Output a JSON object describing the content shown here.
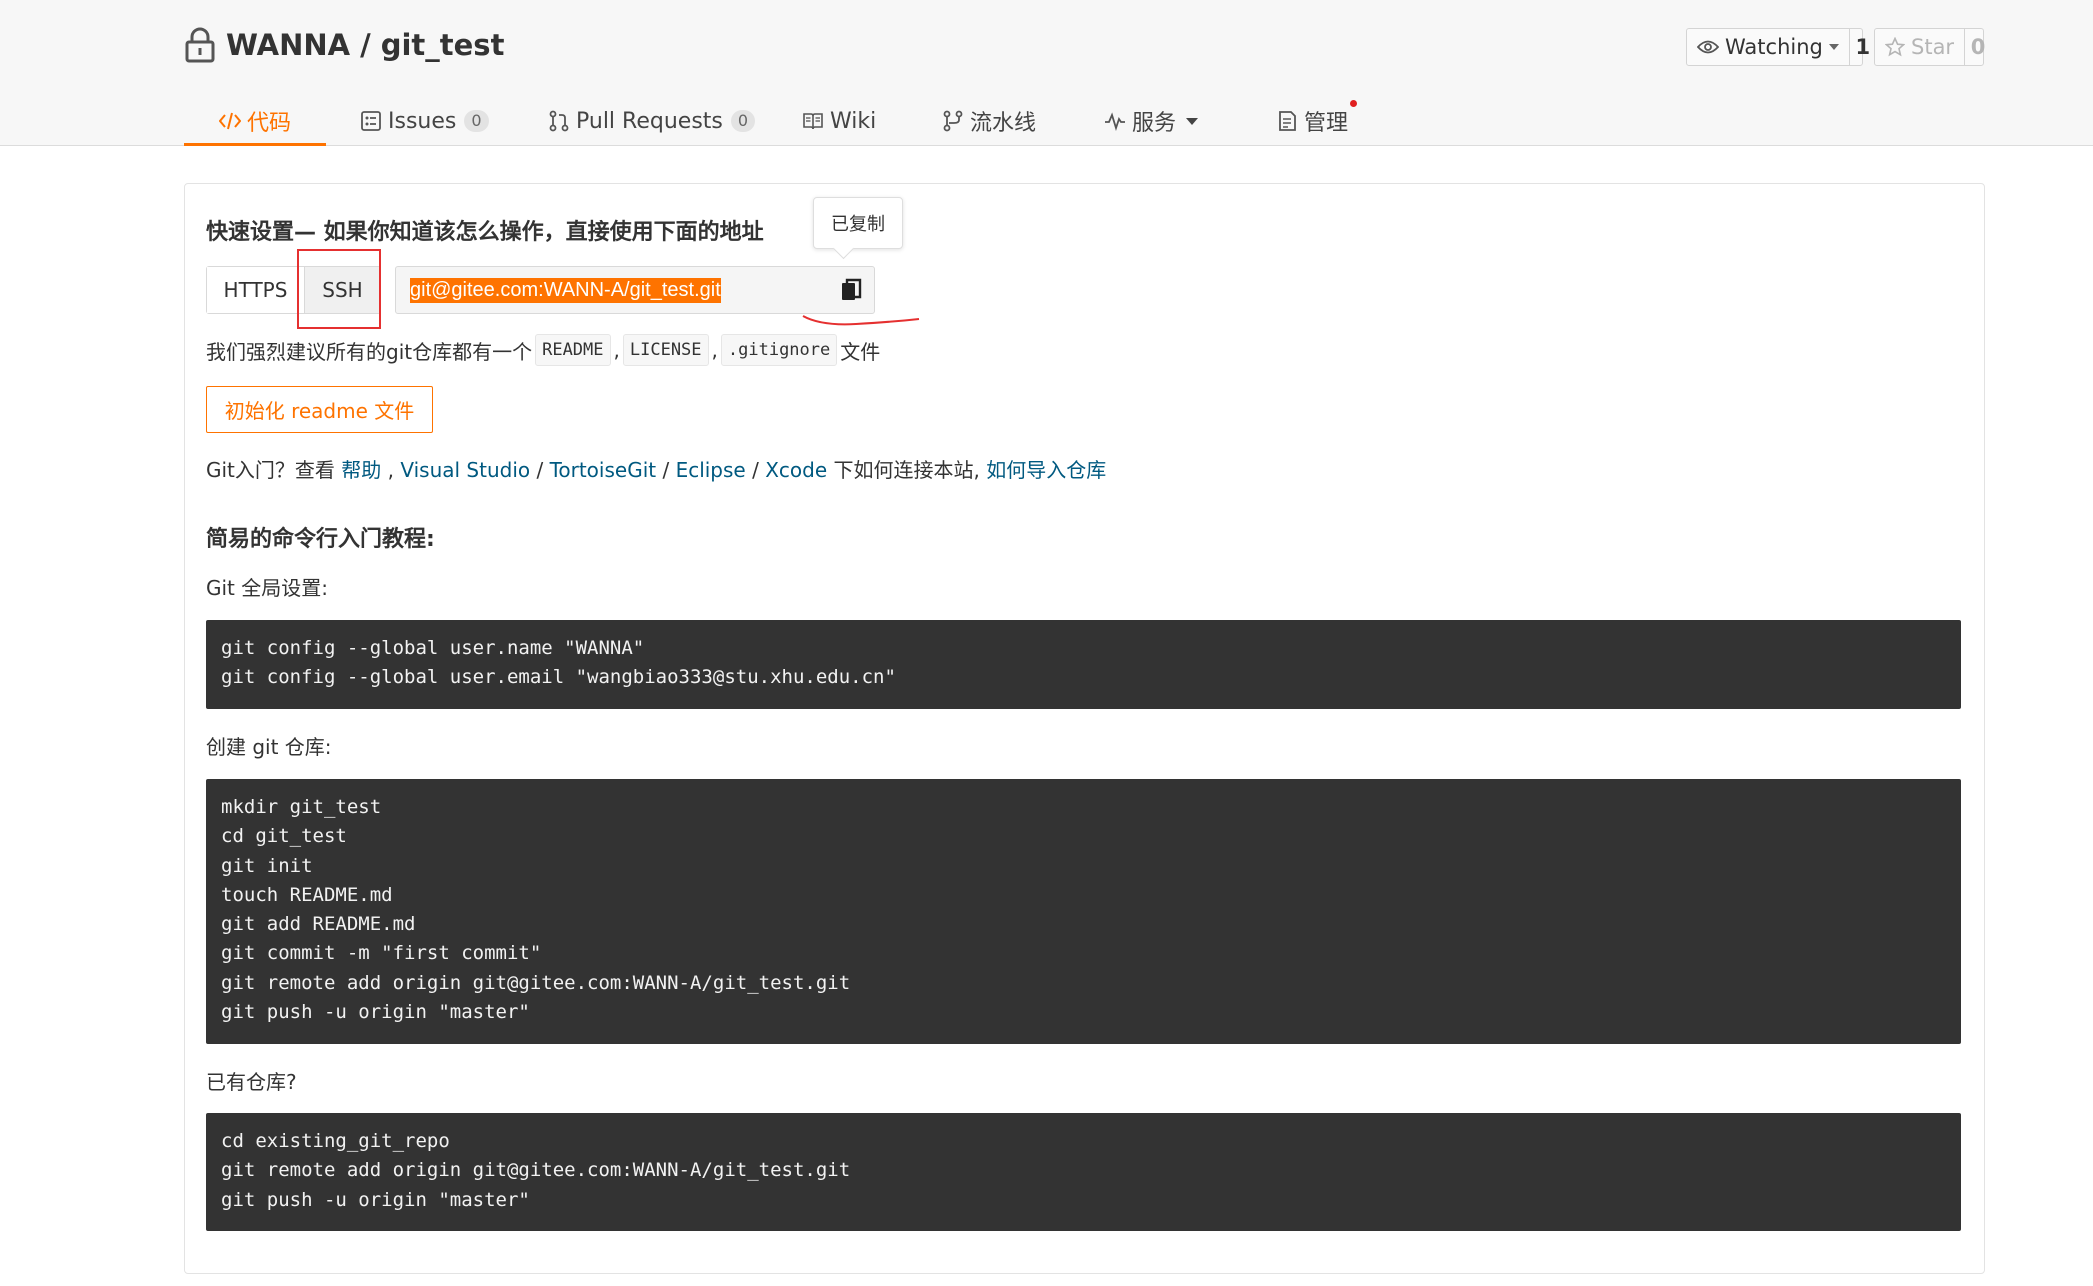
{
  "repo": {
    "owner": "WANNA",
    "separator": "/",
    "name": "git_test"
  },
  "watch": {
    "label": "Watching",
    "count": "1"
  },
  "star": {
    "label": "Star",
    "count": "0"
  },
  "tabs": [
    {
      "label": "代码",
      "icon": "code-icon",
      "active": true
    },
    {
      "label": "Issues",
      "badge": "0",
      "icon": "issues-icon"
    },
    {
      "label": "Pull Requests",
      "badge": "0",
      "icon": "pull-request-icon"
    },
    {
      "label": "Wiki",
      "icon": "book-icon"
    },
    {
      "label": "流水线",
      "icon": "pipeline-icon"
    },
    {
      "label": "服务",
      "icon": "pulse-icon"
    },
    {
      "label": "管理",
      "icon": "manage-icon"
    }
  ],
  "quick_setup": {
    "title": "快速设置— 如果你知道该怎么操作，直接使用下面的地址",
    "tooltip": "已复制",
    "protocols": [
      "HTTPS",
      "SSH"
    ],
    "url": "git@gitee.com:WANN-A/git_test.git"
  },
  "recommend": {
    "prefix": "我们强烈建议所有的git仓库都有一个",
    "files": [
      "README",
      "LICENSE",
      ".gitignore"
    ],
    "comma": ",",
    "suffix": "文件"
  },
  "init_button": "初始化 readme 文件",
  "help": {
    "prefix": "Git入门？查看 ",
    "help_link": "帮助",
    "comma": " , ",
    "vs_link": "Visual Studio",
    "slash": " / ",
    "tortoise_link": "TortoiseGit",
    "eclipse_link": "Eclipse",
    "xcode_link": "Xcode",
    "middle": " 下如何连接本站, ",
    "import_link": "如何导入仓库"
  },
  "tutorial": {
    "title": "简易的命令行入门教程:",
    "global_label": "Git 全局设置:",
    "global_code": "git config --global user.name \"WANNA\"\ngit config --global user.email \"wangbiao333@stu.xhu.edu.cn\"",
    "create_label": "创建 git 仓库:",
    "create_code": "mkdir git_test\ncd git_test\ngit init\ntouch README.md\ngit add README.md\ngit commit -m \"first commit\"\ngit remote add origin git@gitee.com:WANN-A/git_test.git\ngit push -u origin \"master\"",
    "existing_label": "已有仓库?",
    "existing_code": "cd existing_git_repo\ngit remote add origin git@gitee.com:WANN-A/git_test.git\ngit push -u origin \"master\""
  },
  "colors": {
    "accent": "#fe7300",
    "link": "#005980",
    "code_bg": "#333333",
    "annotation_red": "#e53030"
  }
}
